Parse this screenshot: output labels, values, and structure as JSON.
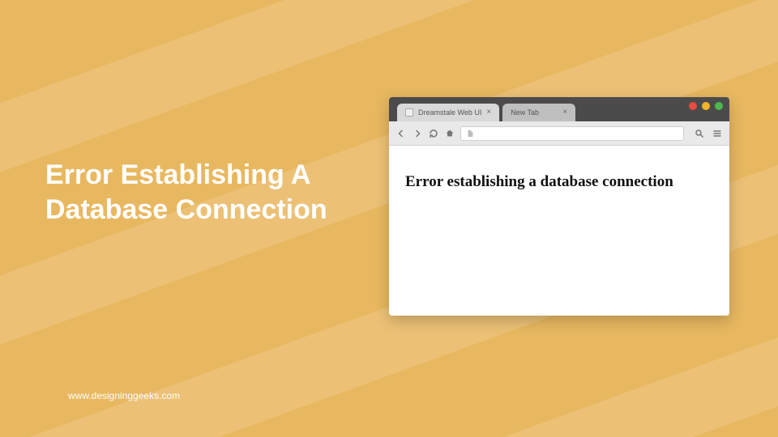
{
  "headline": "Error Establishing A Database Connection",
  "footer_url": "www.designinggeeks.com",
  "browser": {
    "tabs": [
      {
        "label": "Dreamstale Web UI",
        "active": true
      },
      {
        "label": "New Tab",
        "active": false
      }
    ],
    "page": {
      "error_heading": "Error establishing a database connection"
    }
  }
}
